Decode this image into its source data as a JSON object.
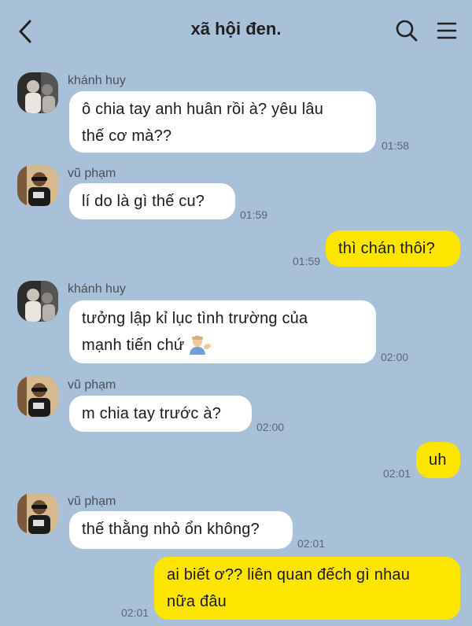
{
  "header": {
    "title": "xã hội đen."
  },
  "icons": {
    "back": "chevron-left-icon",
    "search": "search-icon",
    "menu": "hamburger-menu-icon"
  },
  "colors": {
    "background": "#a9c0d9",
    "my_bubble": "#fee500",
    "their_bubble": "#ffffff"
  },
  "messages": [
    {
      "sender": "khánh huy",
      "lines": [
        "ô chia tay anh huân rồi à? yêu lâu",
        "thế cơ mà??"
      ],
      "time": "01:58"
    },
    {
      "sender": "vũ phạm",
      "lines": [
        "lí do là gì thế cu?"
      ],
      "time": "01:59"
    },
    {
      "sender": "me",
      "lines": [
        "thì chán thôi?"
      ],
      "time": "01:59"
    },
    {
      "sender": "khánh huy",
      "lines": [
        "tưởng lập kỉ lục tình trường của",
        "mạnh tiến chứ"
      ],
      "time": "02:00",
      "emoji": "man-tipping-hand"
    },
    {
      "sender": "vũ phạm",
      "lines": [
        "m chia tay trước à?"
      ],
      "time": "02:00"
    },
    {
      "sender": "me",
      "lines": [
        "uh"
      ],
      "time": "02:01"
    },
    {
      "sender": "vũ phạm",
      "lines": [
        "thế thằng nhỏ ổn không?"
      ],
      "time": "02:01"
    },
    {
      "sender": "me",
      "lines": [
        "ai biết ơ?? liên quan đếch gì nhau",
        "nữa đâu"
      ],
      "time": "02:01"
    }
  ]
}
